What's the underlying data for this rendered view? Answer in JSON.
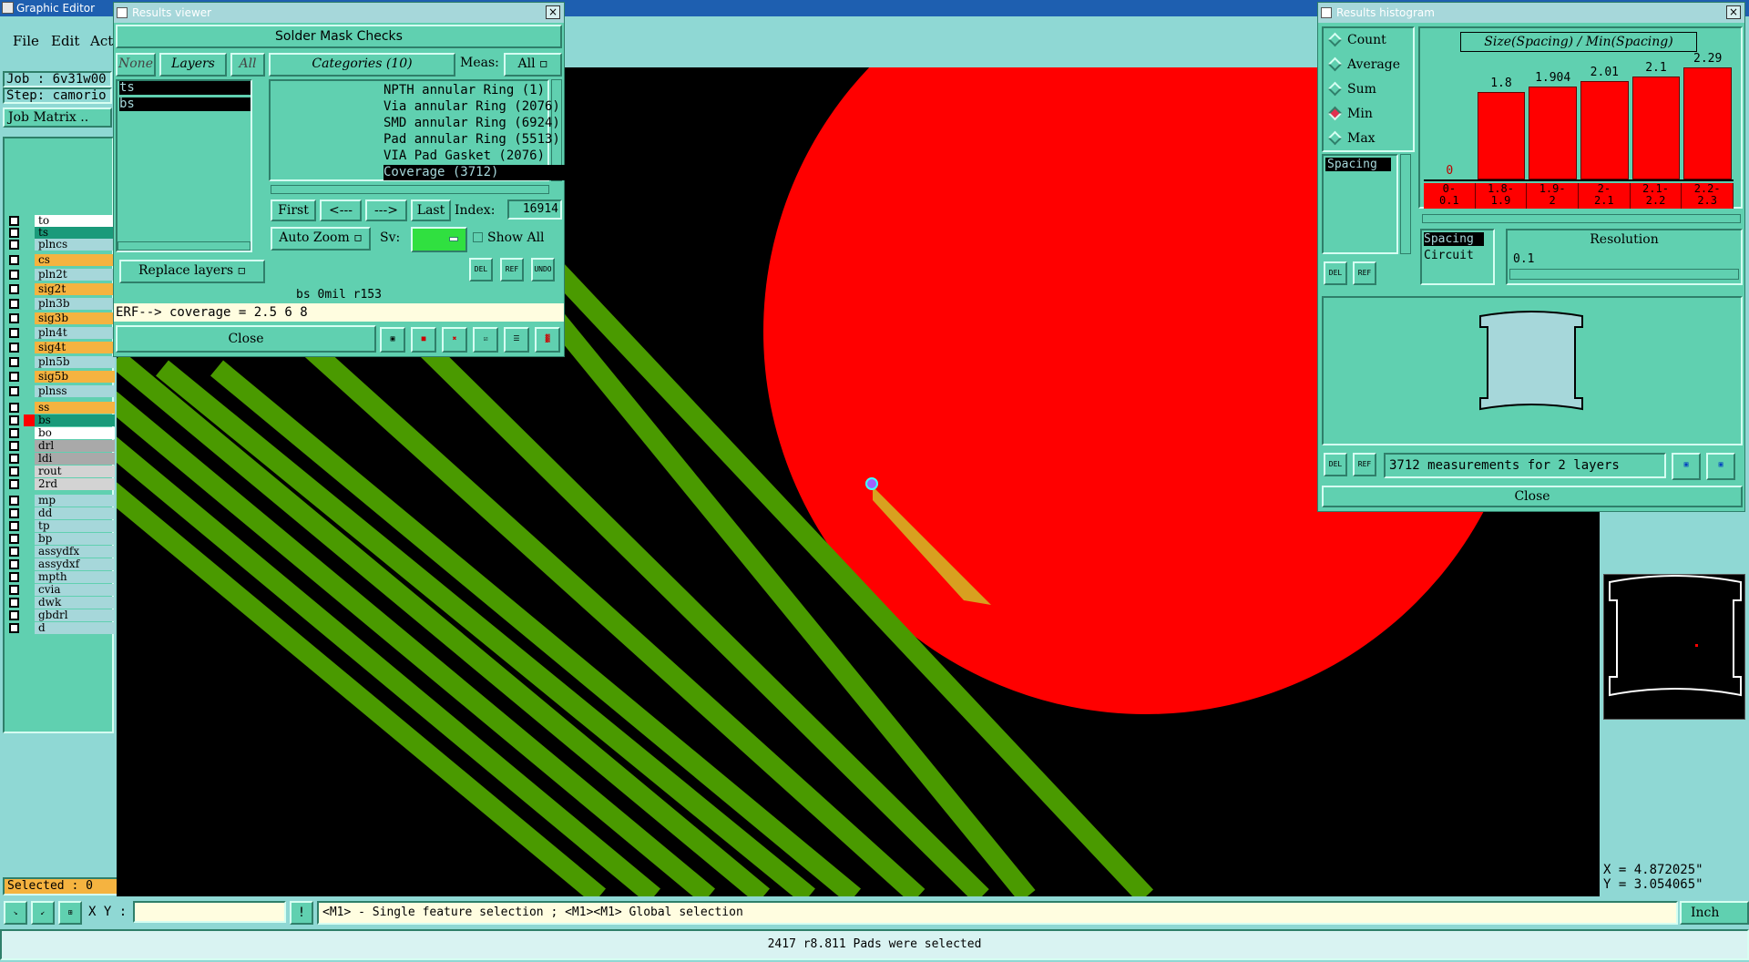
{
  "main_window": {
    "title": "Graphic Editor",
    "menu": [
      "File",
      "Edit",
      "Act"
    ],
    "job_label": "Job : 6v31w00",
    "step_label": "Step: camorio",
    "job_matrix": "Job Matrix ..",
    "selected": "Selected : 0",
    "xy_label": "X Y :",
    "xy_value": "",
    "status_hint": "<M1> - Single feature selection ; <M1><M1> Global selection",
    "units": "Inch",
    "bottom_status": "2417 r8.811 Pads were selected",
    "coord_x": "X = 4.872025\"",
    "coord_y": "Y = 3.054065\""
  },
  "layers": [
    {
      "name": "to",
      "color": "#ffffff",
      "fill": "#ffffff"
    },
    {
      "name": "ts",
      "color": "#1a9a7a",
      "fill": "#1a9a7a"
    },
    {
      "name": "plncs",
      "color": "#a6d7da",
      "fill": "#a6d7da"
    },
    {
      "name": "cs",
      "color": "#f5b340",
      "fill": "#f5b340"
    },
    {
      "name": "pln2t",
      "color": "#a6d7da",
      "fill": "#a6d7da"
    },
    {
      "name": "sig2t",
      "color": "#f5b340",
      "fill": "#f5b340"
    },
    {
      "name": "pln3b",
      "color": "#a6d7da",
      "fill": "#a6d7da"
    },
    {
      "name": "sig3b",
      "color": "#f5b340",
      "fill": "#f5b340"
    },
    {
      "name": "pln4t",
      "color": "#a6d7da",
      "fill": "#a6d7da"
    },
    {
      "name": "sig4t",
      "color": "#f5b340",
      "fill": "#f5b340"
    },
    {
      "name": "pln5b",
      "color": "#a6d7da",
      "fill": "#a6d7da"
    },
    {
      "name": "sig5b",
      "color": "#f5b340",
      "fill": "#f5b340"
    },
    {
      "name": "plnss",
      "color": "#a6d7da",
      "fill": "#a6d7da"
    },
    {
      "name": "ss",
      "color": "#f5b340",
      "fill": "#f5b340"
    },
    {
      "name": "bs",
      "color": "#1a9a7a",
      "fill": "#1a9a7a"
    },
    {
      "name": "bo",
      "color": "#ffffff",
      "fill": "#ffffff"
    },
    {
      "name": "drl",
      "color": "#a9a9a9",
      "fill": "#a9a9a9"
    },
    {
      "name": "ldi",
      "color": "#a9a9a9",
      "fill": "#a9a9a9"
    },
    {
      "name": "rout",
      "color": "#d3d3d3",
      "fill": "#d3d3d3"
    },
    {
      "name": "2rd",
      "color": "#d3d3d3",
      "fill": "#d3d3d3"
    },
    {
      "name": "mp",
      "color": "#a6d7da",
      "fill": "#a6d7da"
    },
    {
      "name": "dd",
      "color": "#a6d7da",
      "fill": "#a6d7da"
    },
    {
      "name": "tp",
      "color": "#a6d7da",
      "fill": "#a6d7da"
    },
    {
      "name": "bp",
      "color": "#a6d7da",
      "fill": "#a6d7da"
    },
    {
      "name": "assydfx",
      "color": "#a6d7da",
      "fill": "#a6d7da"
    },
    {
      "name": "assydxf",
      "color": "#a6d7da",
      "fill": "#a6d7da"
    },
    {
      "name": "mpth",
      "color": "#a6d7da",
      "fill": "#a6d7da"
    },
    {
      "name": "cvia",
      "color": "#a6d7da",
      "fill": "#a6d7da"
    },
    {
      "name": "dwk",
      "color": "#a6d7da",
      "fill": "#a6d7da"
    },
    {
      "name": "gbdrl",
      "color": "#a6d7da",
      "fill": "#a6d7da"
    },
    {
      "name": "d",
      "color": "#a6d7da",
      "fill": "#a6d7da"
    }
  ],
  "results_viewer": {
    "title": "Results viewer",
    "header": "Solder Mask Checks",
    "none_btn": "None",
    "layers_btn": "Layers",
    "all_btn": "All",
    "layer_items": [
      "ts",
      "bs"
    ],
    "categories_btn": "Categories (10)",
    "meas_label": "Meas:",
    "meas_value": "All",
    "categories": [
      "NPTH annular Ring (1)",
      "Via annular Ring (2076)",
      "SMD annular Ring (6924)",
      "Pad annular Ring (5513)",
      "VIA Pad Gasket (2076)",
      "Coverage (3712)"
    ],
    "first_btn": "First",
    "prev_btn": "<---",
    "next_btn": "--->",
    "last_btn": "Last",
    "index_label": "Index:",
    "index_value": "16914",
    "auto_zoom": "Auto Zoom",
    "sv_label": "Sv:",
    "show_all": "Show All",
    "replace_layers": "Replace layers",
    "del": "DEL",
    "ref": "REF",
    "undo": "UNDO",
    "info_line": "bs 0mil   r153",
    "erf_line": "ERF--> coverage = 2.5 6 8",
    "close": "Close"
  },
  "histogram": {
    "title": "Results histogram",
    "modes": [
      "Count",
      "Average",
      "Sum",
      "Min",
      "Max"
    ],
    "selected_mode": "Min",
    "chart_title": "Size(Spacing) / Min(Spacing)",
    "list_items": [
      "Spacing"
    ],
    "resolution_items": [
      "Spacing",
      "Circuit"
    ],
    "resolution_label": "Resolution",
    "resolution_value": "0.1",
    "summary": "3712 measurements for 2 layers",
    "del": "DEL",
    "ref": "REF",
    "close": "Close"
  },
  "chart_data": {
    "type": "bar",
    "title": "Size(Spacing) / Min(Spacing)",
    "categories": [
      "0-\n0.1",
      "1.8-\n1.9",
      "1.9-\n2",
      "2-\n2.1",
      "2.1-\n2.2",
      "2.2-\n2.3"
    ],
    "category_labels": [
      [
        "0-",
        "0.1"
      ],
      [
        "1.8-",
        "1.9"
      ],
      [
        "1.9-",
        "2"
      ],
      [
        "2-",
        "2.1"
      ],
      [
        "2.1-",
        "2.2"
      ],
      [
        "2.2-",
        "2.3"
      ]
    ],
    "values": [
      0,
      1.8,
      1.904,
      2.01,
      2.1,
      2.29
    ],
    "value_labels": [
      "0",
      "1.8",
      "1.904",
      "2.01",
      "2.1",
      "2.29"
    ],
    "ylim": [
      0,
      2.5
    ]
  }
}
